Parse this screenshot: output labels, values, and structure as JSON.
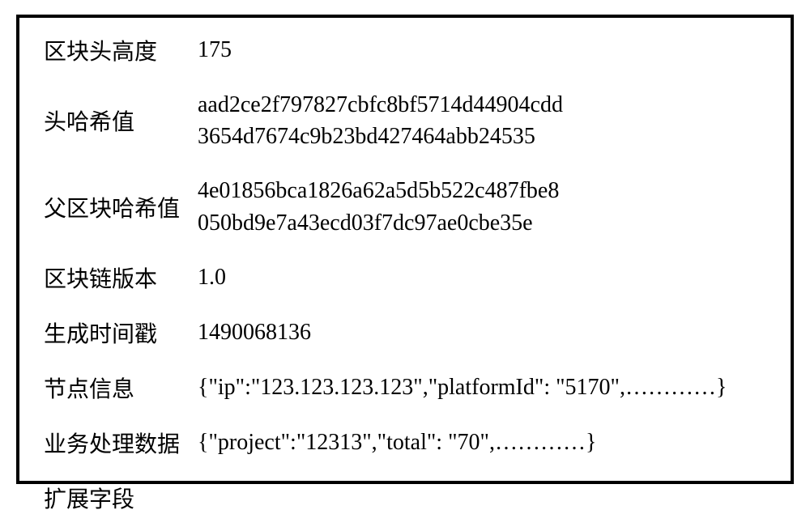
{
  "fields": {
    "block_height": {
      "label": "区块头高度",
      "value": "175"
    },
    "header_hash": {
      "label": "头哈希值",
      "value_line1": "aad2ce2f797827cbfc8bf5714d44904cdd",
      "value_line2": "3654d7674c9b23bd427464abb24535"
    },
    "parent_hash": {
      "label": "父区块哈希值",
      "value_line1": "4e01856bca1826a62a5d5b522c487fbe8",
      "value_line2": "050bd9e7a43ecd03f7dc97ae0cbe35e"
    },
    "chain_version": {
      "label": "区块链版本",
      "value": "1.0"
    },
    "timestamp": {
      "label": "生成时间戳",
      "value": "1490068136"
    },
    "node_info": {
      "label": "节点信息",
      "value": "{\"ip\":\"123.123.123.123\",\"platformId\": \"5170\",…………}"
    },
    "business_data": {
      "label": "业务处理数据",
      "value": "{\"project\":\"12313\",\"total\": \"70\",…………}"
    },
    "extended_field": {
      "label": "扩展字段",
      "value": ""
    }
  }
}
